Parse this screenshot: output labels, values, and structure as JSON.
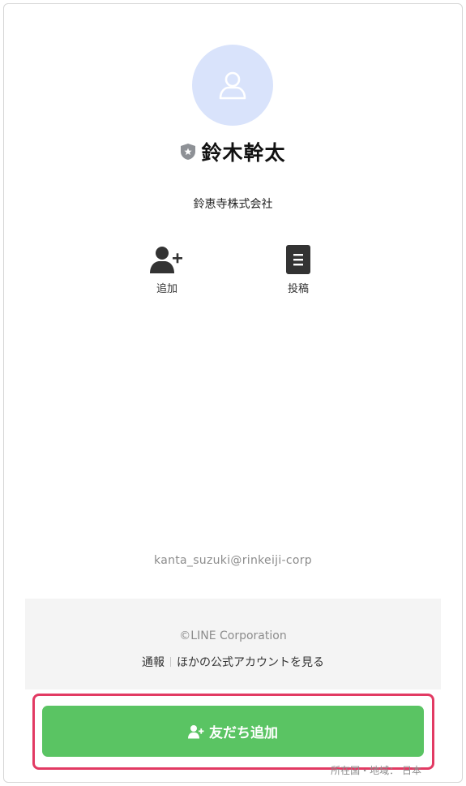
{
  "profile": {
    "name": "鈴木幹太",
    "company": "鈴恵寺株式会社",
    "avatar_icon": "user-outline-icon",
    "badge_icon": "shield-star-icon"
  },
  "actions": {
    "add_label": "追加",
    "post_label": "投稿"
  },
  "contact": {
    "email": "kanta_suzuki@rinkeiji-corp"
  },
  "footer": {
    "copyright": "©LINE Corporation",
    "report_label": "通報",
    "other_accounts_label": "ほかの公式アカウントを見る"
  },
  "primary_button": {
    "label": "友だち追加",
    "color": "#5ac463"
  },
  "region_text": "所在国・地域：  日本",
  "colors": {
    "avatar_bg": "#d9e3fb",
    "highlight": "#e23a63"
  }
}
